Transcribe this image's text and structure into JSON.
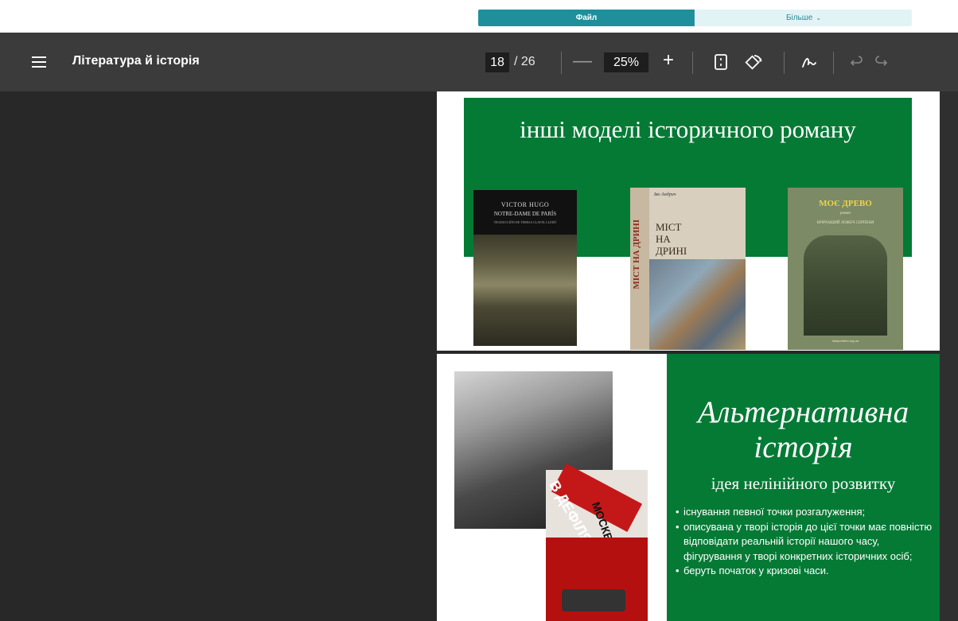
{
  "top_tabs": {
    "file": "Файл",
    "more": "Більше",
    "more_chevron": "⌄"
  },
  "toolbar": {
    "title": "Література й історія",
    "page_current": "18",
    "page_total": "/ 26",
    "zoom_minus": "—",
    "zoom": "25%",
    "zoom_plus": "+"
  },
  "slide1": {
    "title": "інші моделі історичного роману",
    "book1": {
      "line1": "VICTOR HUGO",
      "line2": "NOTRE-DAME DE PARÍS",
      "line3": "TRADUCCIÓN DE TERESA CLAVEL LLEDÓ"
    },
    "book2": {
      "author": "Іво Андрич",
      "spine": "МІСТ НА ДРИНІ",
      "front": "МІСТ\nНА\nДРИНІ"
    },
    "book3": {
      "title": "МОЄ ДРЕВО",
      "line2": "роман",
      "line3": "КРИЧАЩИЙ ЛОЖЕЧ СЕРПЕНЯ",
      "foot": "diasporiana.org.ua"
    }
  },
  "slide2": {
    "title": "Альтернативна історія",
    "subtitle": "ідея нелінійного розвитку",
    "poster": {
      "line1": "В ДЕФІЛЯДІ",
      "line2": "МОСКВІ"
    },
    "bullets": [
      "існування певної точки розгалуження;",
      "описувана у творі історія до цієї точки має повністю відповідати реальній історії нашого часу,  фігурування у творі конкретних історичних осіб;",
      "беруть початок у кризові часи."
    ]
  },
  "colors": {
    "accent_teal": "#1f8f9b",
    "toolbar_bg": "#3b3b3b",
    "canvas_bg": "#282828",
    "slide_green": "#057a35"
  },
  "icons": [
    "menu-icon",
    "fit-page-icon",
    "rotate-icon",
    "draw-icon",
    "undo-icon",
    "redo-icon"
  ]
}
